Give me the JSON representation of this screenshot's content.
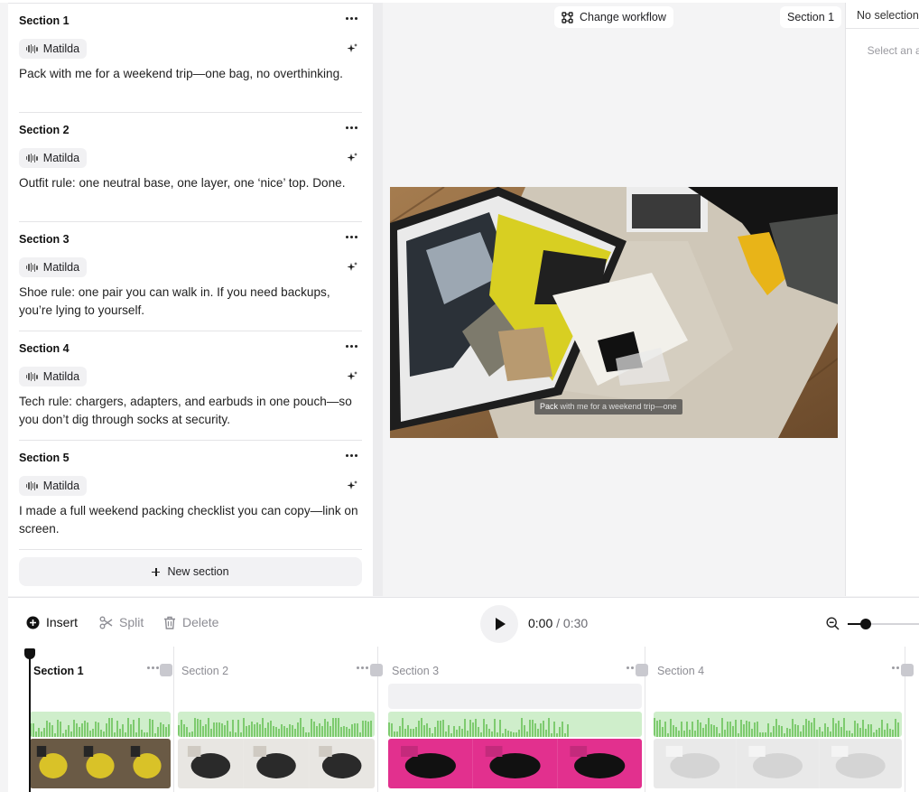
{
  "script": {
    "sections": [
      {
        "title": "Section 1",
        "voice": "Matilda",
        "text": "Pack with me for a weekend trip—one bag, no overthinking."
      },
      {
        "title": "Section 2",
        "voice": "Matilda",
        "text": "Outfit rule: one neutral base, one layer, one ‘nice’ top. Done."
      },
      {
        "title": "Section 3",
        "voice": "Matilda",
        "text": "Shoe rule: one pair you can walk in. If you need backups, you’re lying to yourself."
      },
      {
        "title": "Section 4",
        "voice": "Matilda",
        "text": "Tech rule: chargers, adapters, and earbuds in one pouch—so you don’t dig through socks at security."
      },
      {
        "title": "Section 5",
        "voice": "Matilda",
        "text": "I made a full weekend packing checklist you can copy—link on screen."
      }
    ],
    "new_section_label": "New section"
  },
  "preview": {
    "change_workflow_label": "Change workflow",
    "section_label": "Section 1",
    "caption_highlight": "Pack",
    "caption_rest": " with me for a weekend trip—one"
  },
  "inspector": {
    "title": "No selection",
    "hint": "Select an asset to view its properties"
  },
  "timeline": {
    "insert_label": "Insert",
    "split_label": "Split",
    "delete_label": "Delete",
    "time_current": "0:00",
    "time_separator": " / ",
    "time_total": "0:30",
    "zoom_level": 0.25,
    "clips": [
      {
        "title": "Section 1"
      },
      {
        "title": "Section 2"
      },
      {
        "title": "Section 3"
      },
      {
        "title": "Section 4"
      }
    ]
  },
  "colors": {
    "accent": "#111111",
    "audio_waveform": "#7ecb6f",
    "audio_bg": "#cfeecb",
    "muted_text": "#8d8d94"
  }
}
